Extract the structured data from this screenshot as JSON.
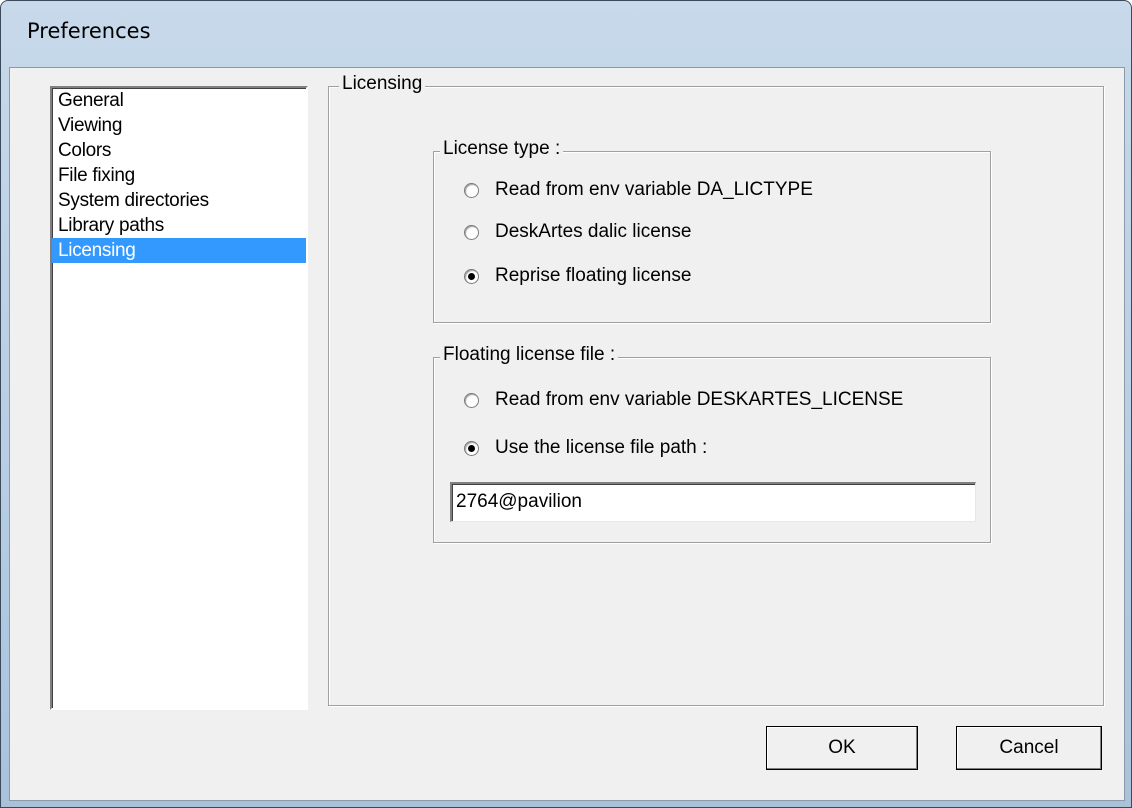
{
  "window": {
    "title": "Preferences"
  },
  "sidebar": {
    "items": [
      {
        "label": "General"
      },
      {
        "label": "Viewing"
      },
      {
        "label": "Colors"
      },
      {
        "label": "File fixing"
      },
      {
        "label": "System directories"
      },
      {
        "label": "Library paths"
      },
      {
        "label": "Licensing",
        "selected": true
      }
    ]
  },
  "panel": {
    "title": "Licensing",
    "license_type": {
      "label": "License type :",
      "options": [
        {
          "label": "Read from env variable DA_LICTYPE",
          "checked": false
        },
        {
          "label": "DeskArtes dalic license",
          "checked": false
        },
        {
          "label": "Reprise floating license",
          "checked": true
        }
      ]
    },
    "floating_file": {
      "label": "Floating license file :",
      "options": [
        {
          "label": "Read from env variable DESKARTES_LICENSE",
          "checked": false
        },
        {
          "label": "Use the license file path :",
          "checked": true
        }
      ],
      "path_value": "2764@pavilion"
    }
  },
  "buttons": {
    "ok": "OK",
    "cancel": "Cancel"
  },
  "colors": {
    "selection": "#3399ff",
    "dialog_bg": "#f0f0f0"
  }
}
